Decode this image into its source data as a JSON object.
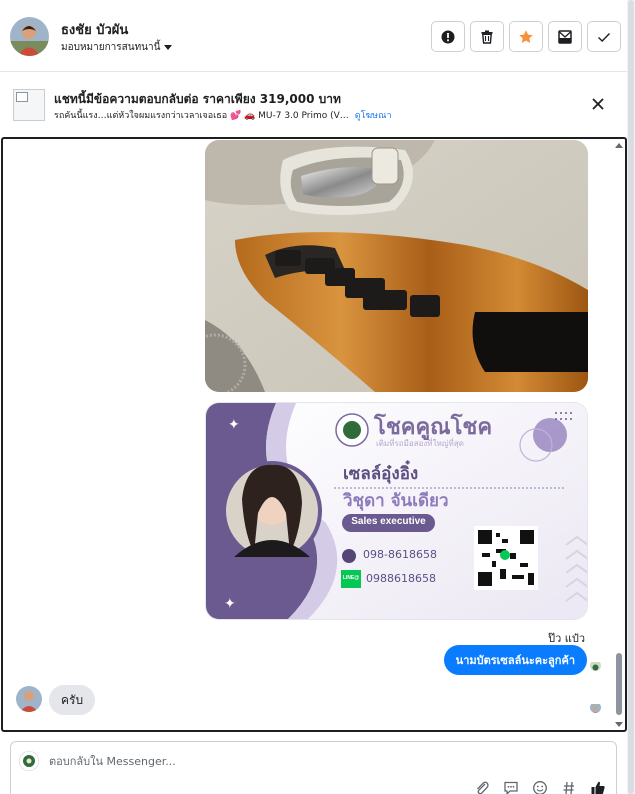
{
  "header": {
    "contact_name": "ธงชัย บัวผัน",
    "assign_label": "มอบหมายการสนทนานี้",
    "actions": [
      "alert-icon",
      "trash-icon",
      "star-icon",
      "mark-unread-icon",
      "check-icon"
    ],
    "accent_color": "#f7923a"
  },
  "listing": {
    "title": "แชทนี้มีข้อความตอบกลับต่อ ราคาเพียง 319,000 บาท",
    "subtitle": "รถคันนี้แรง…แต่หัวใจผมแรงกว่าเวลาเจอเธอ 💕 🚗 MU-7 3.0 Primo (V…",
    "link_label": "ดูโฆษณา"
  },
  "card": {
    "brand": "โชคคูณโชค",
    "tagline": "เติมที่รถมือสองที่ใหญ่ที่สุด",
    "nickname": "เซลล์อุ๋งอิ๋ง",
    "full_name": "วิชุดา จันเดียว",
    "role": "Sales executive",
    "phone": "098-8618658",
    "line_badge": "LINE@",
    "line_id": "0988618658"
  },
  "messages": {
    "seen_label": "ป๊ว แป๋ว",
    "outgoing_text": "นามบัตรเซลล์นะคะลูกค้า",
    "incoming_text": "ครับ",
    "bubble_color": "#0a7cff"
  },
  "composer": {
    "placeholder": "ตอบกลับใน Messenger...",
    "tools": [
      "attach-icon",
      "saved-reply-icon",
      "emoji-icon",
      "hashtag-icon",
      "like-icon"
    ]
  }
}
